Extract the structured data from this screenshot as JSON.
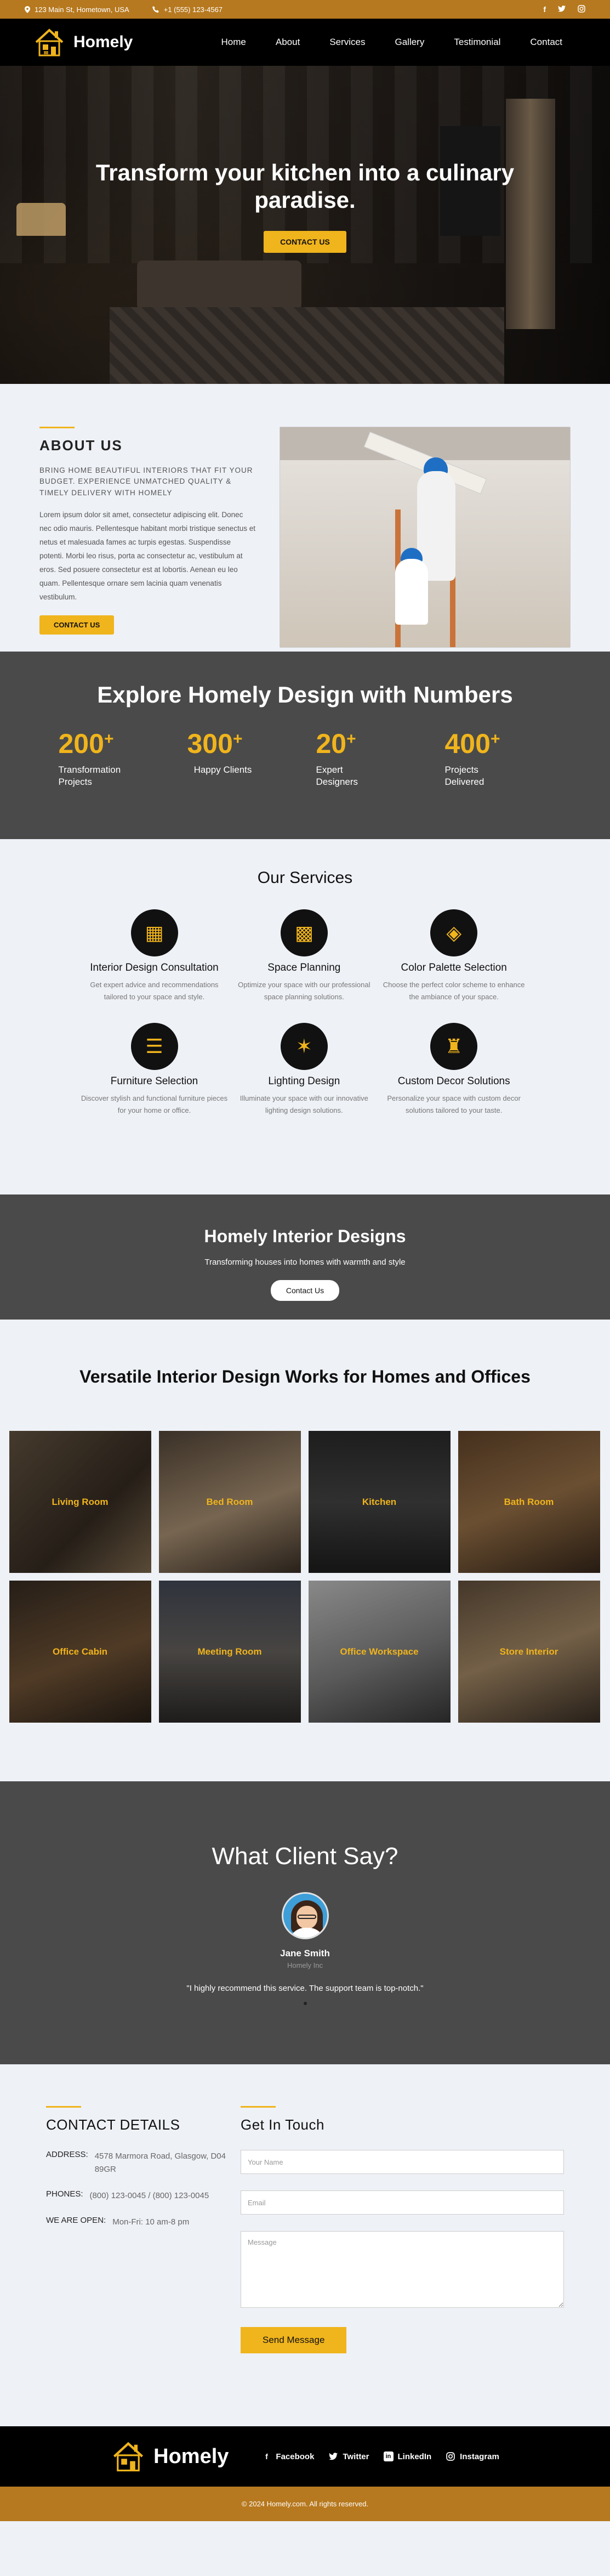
{
  "topbar": {
    "address": "123 Main St, Hometown, USA",
    "phone": "+1 (555) 123-4567",
    "socials": [
      {
        "icon": "facebook-icon",
        "glyph": "f"
      },
      {
        "icon": "twitter-icon",
        "glyph": "🐦"
      },
      {
        "icon": "instagram-icon",
        "glyph": "◎"
      }
    ]
  },
  "nav": {
    "brand": "Homely",
    "items": [
      "Home",
      "About",
      "Services",
      "Gallery",
      "Testimonial",
      "Contact"
    ]
  },
  "hero": {
    "title": "Transform your kitchen into a culinary paradise.",
    "cta": "Contact Us"
  },
  "about": {
    "heading": "ABOUT US",
    "subheading": "BRING HOME BEAUTIFUL INTERIORS THAT FIT YOUR BUDGET. EXPERIENCE UNMATCHED QUALITY & TIMELY DELIVERY WITH HOMELY",
    "body": "Lorem ipsum dolor sit amet, consectetur adipiscing elit. Donec nec odio mauris. Pellentesque habitant morbi tristique senectus et netus et malesuada fames ac turpis egestas. Suspendisse potenti. Morbi leo risus, porta ac consectetur ac, vestibulum at eros. Sed posuere consectetur est at lobortis. Aenean eu leo quam. Pellentesque ornare sem lacinia quam venenatis vestibulum.",
    "cta": "Contact Us"
  },
  "numbers": {
    "heading": "Explore Homely Design with Numbers",
    "stats": [
      {
        "value": "200",
        "suffix": "+",
        "label": "Transformation Projects"
      },
      {
        "value": "300",
        "suffix": "+",
        "label": "Happy Clients"
      },
      {
        "value": "20",
        "suffix": "+",
        "label": "Expert Designers"
      },
      {
        "value": "400",
        "suffix": "+",
        "label": "Projects Delivered"
      }
    ]
  },
  "services": {
    "heading": "Our Services",
    "items": [
      {
        "icon": "consultation-icon",
        "glyph": "▦",
        "title": "Interior Design Consultation",
        "desc": "Get expert advice and recommendations tailored to your space and style."
      },
      {
        "icon": "space-planning-icon",
        "glyph": "▩",
        "title": "Space Planning",
        "desc": "Optimize your space with our professional space planning solutions."
      },
      {
        "icon": "color-palette-icon",
        "glyph": "◈",
        "title": "Color Palette Selection",
        "desc": "Choose the perfect color scheme to enhance the ambiance of your space."
      },
      {
        "icon": "furniture-icon",
        "glyph": "☰",
        "title": "Furniture Selection",
        "desc": "Discover stylish and functional furniture pieces for your home or office."
      },
      {
        "icon": "lighting-icon",
        "glyph": "✶",
        "title": "Lighting Design",
        "desc": "Illuminate your space with our innovative lighting design solutions."
      },
      {
        "icon": "decor-icon",
        "glyph": "♜",
        "title": "Custom Decor Solutions",
        "desc": "Personalize your space with custom decor solutions tailored to your taste."
      }
    ]
  },
  "banner": {
    "heading": "Homely Interior Designs",
    "tagline": "Transforming houses into homes with warmth and style",
    "cta": "Contact Us"
  },
  "portfolio": {
    "heading": "Versatile Interior Design Works for Homes and Offices",
    "tiles": [
      {
        "label": "Living Room",
        "bg": "linear-gradient(135deg,#6b5a45,#3a2f25 60%,#8a7355)"
      },
      {
        "label": "Bed Room",
        "bg": "linear-gradient(160deg,#5a4b3d,#b79c7c 55%,#3f3329)"
      },
      {
        "label": "Kitchen",
        "bg": "linear-gradient(180deg,#2e2e2e,#4a4a4a 50%,#1f1f1f)"
      },
      {
        "label": "Bath Room",
        "bg": "linear-gradient(160deg,#6b4a2e,#a47a4d 50%,#3b2a1c)"
      },
      {
        "label": "Office Cabin",
        "bg": "linear-gradient(160deg,#3b2f25,#7a5a3a 55%,#2a2119)"
      },
      {
        "label": "Meeting Room",
        "bg": "linear-gradient(180deg,#4a4f5e,#6e6a66 50%,#2f2c2a)"
      },
      {
        "label": "Office Workspace",
        "bg": "linear-gradient(160deg,#d2d2d2,#8a8a8a 55%,#3a3a3a)"
      },
      {
        "label": "Store Interior",
        "bg": "linear-gradient(160deg,#6a5642,#b2946e 50%,#3d3127)"
      }
    ]
  },
  "testimonial": {
    "heading": "What Client Say?",
    "name": "Jane Smith",
    "role": "Homely Inc",
    "quote": "\"I highly recommend this service. The support team is top-notch.\""
  },
  "contact": {
    "heading": "CONTACT DETAILS",
    "rows": [
      {
        "k": "ADDRESS:",
        "v": "4578 Marmora Road, Glasgow, D04 89GR"
      },
      {
        "k": "PHONES:",
        "v": "(800) 123-0045 / (800) 123-0045"
      },
      {
        "k": "WE ARE OPEN:",
        "v": "Mon-Fri: 10 am-8 pm"
      }
    ],
    "form_heading": "Get In Touch",
    "name_placeholder": "Your Name",
    "email_placeholder": "Email",
    "message_placeholder": "Message",
    "submit": "Send Message"
  },
  "footer": {
    "brand": "Homely",
    "links": [
      {
        "icon": "facebook-icon",
        "glyph": "f",
        "label": "Facebook"
      },
      {
        "icon": "twitter-icon",
        "glyph": "🐦",
        "label": "Twitter"
      },
      {
        "icon": "linkedin-icon",
        "glyph": "in",
        "label": "LinkedIn"
      },
      {
        "icon": "instagram-icon",
        "glyph": "◎",
        "label": "Instagram"
      }
    ],
    "copyright": "© 2024 Homely.com. All rights reserved."
  },
  "colors": {
    "accent": "#f0b41c",
    "topbar": "#b7791f",
    "dark": "#4a4a4a"
  }
}
